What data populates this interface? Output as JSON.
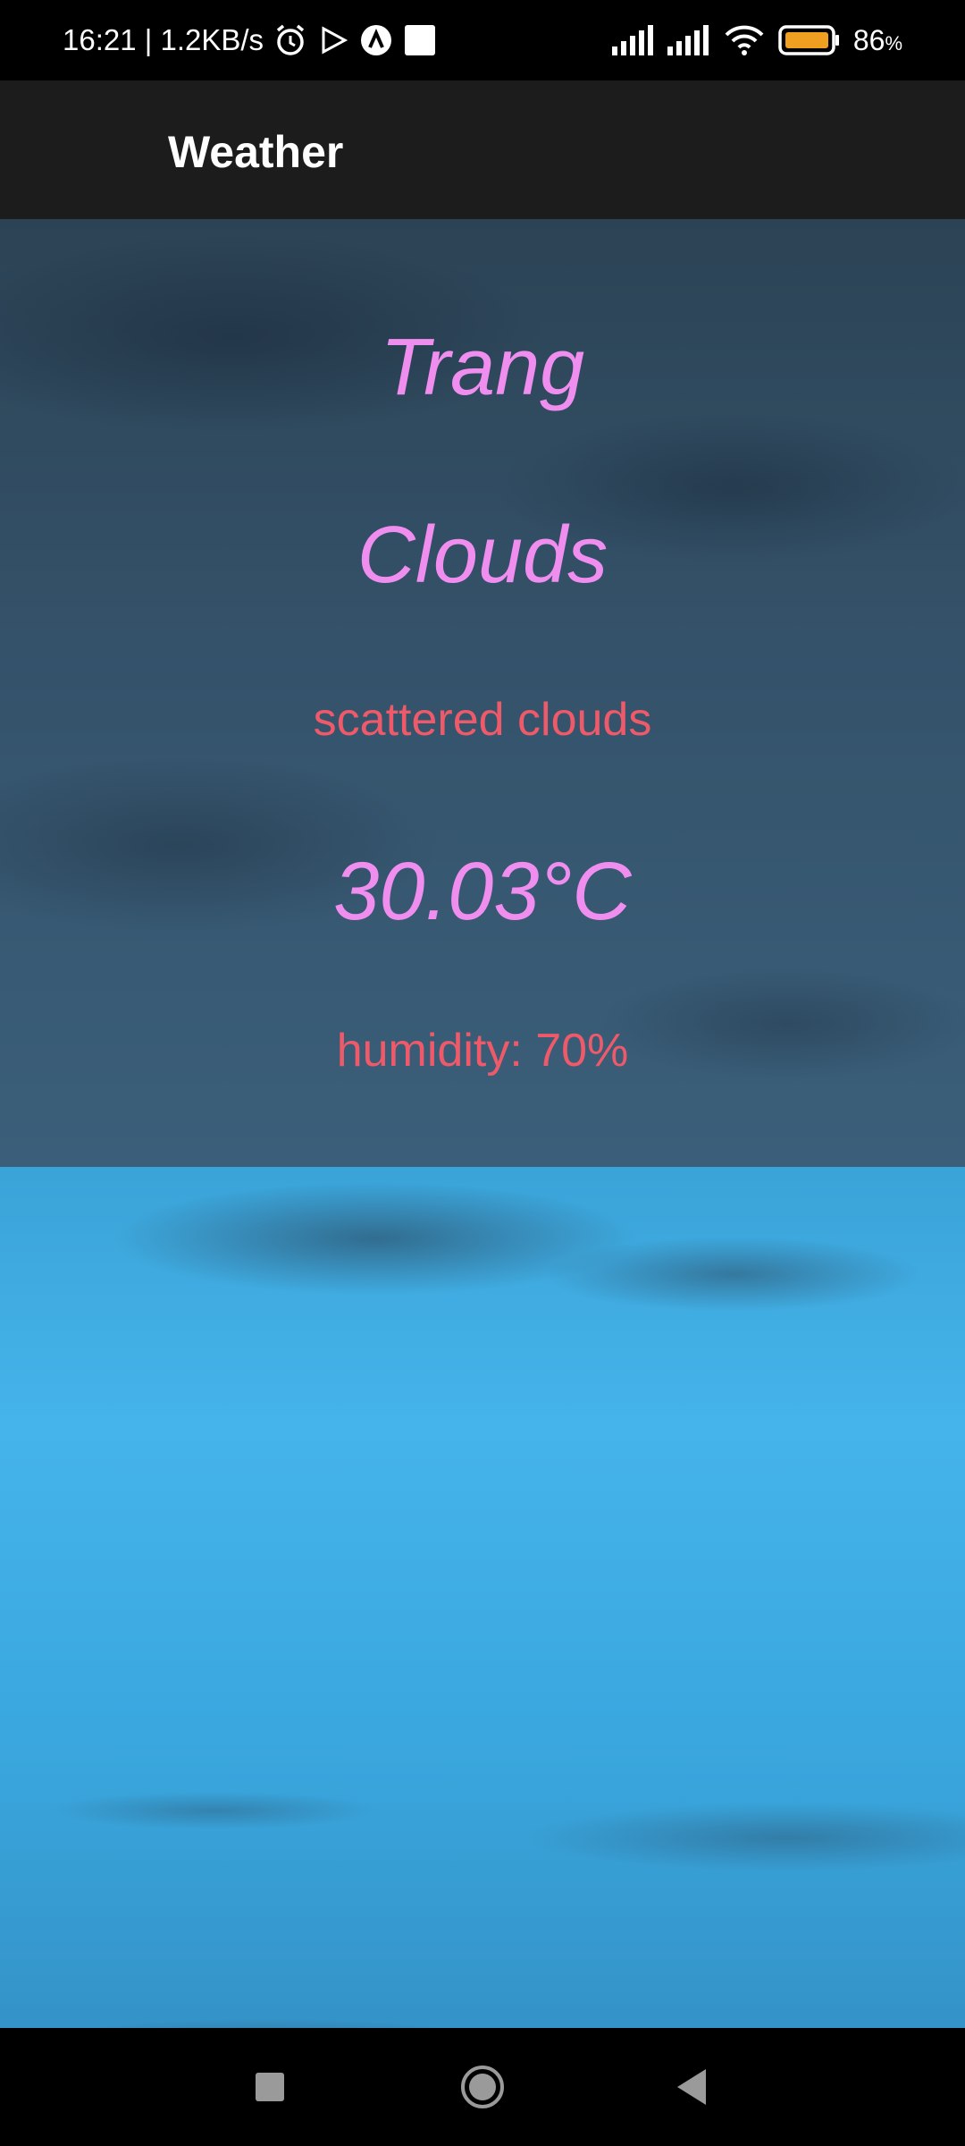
{
  "status_bar": {
    "time_speed": "16:21 | 1.2KB/s",
    "battery_level": "86",
    "battery_unit": "%",
    "icons": [
      "alarm-icon",
      "play-store-icon",
      "app-icon",
      "notification-square-icon",
      "signal-icon",
      "signal-icon",
      "wifi-icon",
      "battery-icon"
    ]
  },
  "app_bar": {
    "title": "Weather"
  },
  "weather": {
    "city": "Trang",
    "condition": "Clouds",
    "description": "scattered clouds",
    "temperature": "30.03°C",
    "humidity": "humidity: 70%"
  },
  "nav_bar": {
    "buttons": [
      "recents-button",
      "home-button",
      "back-button"
    ]
  },
  "colors": {
    "title_pink": "#f08ef0",
    "detail_red": "#ee5a6a",
    "appbar_bg": "#1c1c1c",
    "battery_fill": "#f0a020"
  }
}
